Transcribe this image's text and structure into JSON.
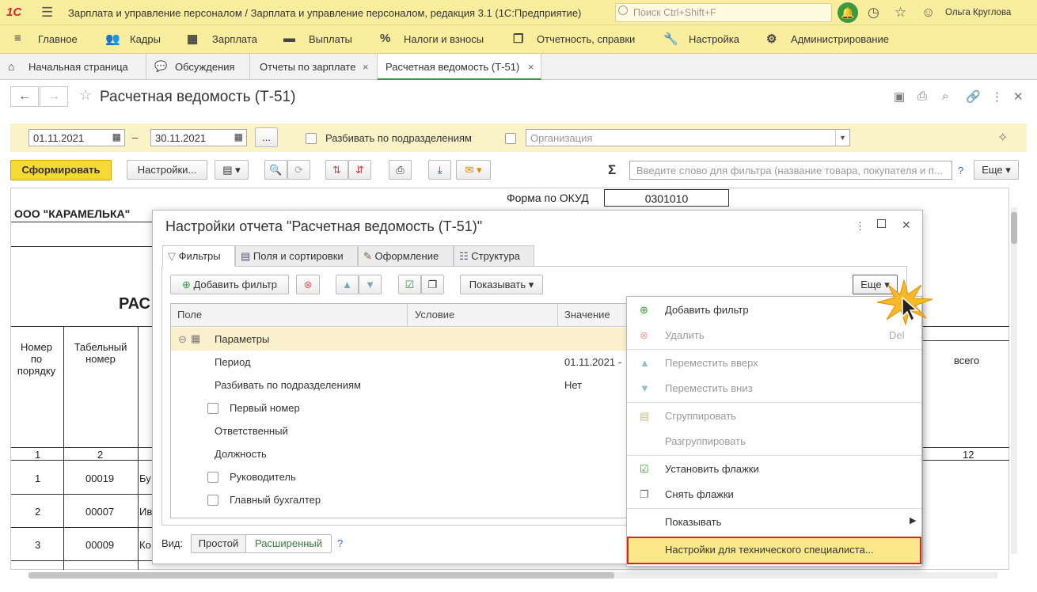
{
  "app": {
    "logo": "1С",
    "title": "Зарплата и управление персоналом / Зарплата и управление персоналом, редакция 3.1  (1С:Предприятие)",
    "search_placeholder": "Поиск Ctrl+Shift+F",
    "user": "Ольга Круглова"
  },
  "sections": [
    "Главное",
    "Кадры",
    "Зарплата",
    "Выплаты",
    "Налоги и взносы",
    "Отчетность, справки",
    "Настройка",
    "Администрирование"
  ],
  "tabs": [
    "Начальная страница",
    "Обсуждения",
    "Отчеты по зарплате",
    "Расчетная ведомость (Т-51)"
  ],
  "form": {
    "title": "Расчетная ведомость (Т-51)",
    "date_from": "01.11.2021",
    "dash": "–",
    "date_to": "30.11.2021",
    "dots": "...",
    "split_label": "Разбивать по подразделениям",
    "org_placeholder": "Организация",
    "generate": "Сформировать",
    "settings": "Настройки...",
    "filter_placeholder": "Введите слово для фильтра (название товара, покупателя и п...",
    "help": "?",
    "more": "Еще"
  },
  "report": {
    "okud_label": "Форма по ОКУД",
    "okud_code": "0301010",
    "org": "ООО \"КАРАМЕЛЬКА\"",
    "title_partial": "РАС",
    "col1": "Номер по порядку",
    "col2": "Табельный номер",
    "col_total": "всего",
    "num_row": [
      "1",
      "2",
      "12"
    ],
    "rows": [
      {
        "n": "1",
        "tab": "00019",
        "name": "Бу"
      },
      {
        "n": "2",
        "tab": "00007",
        "name": "Ив"
      },
      {
        "n": "3",
        "tab": "00009",
        "name": "Ко"
      }
    ]
  },
  "dialog": {
    "title": "Настройки отчета \"Расчетная ведомость (Т-51)\"",
    "tabs": [
      "Фильтры",
      "Поля и сортировки",
      "Оформление",
      "Структура"
    ],
    "add_filter": "Добавить фильтр",
    "show": "Показывать",
    "more": "Еще",
    "grid_headers": [
      "Поле",
      "Условие",
      "Значение"
    ],
    "rows": [
      {
        "label": "Параметры",
        "value": ""
      },
      {
        "label": "Период",
        "value": "01.11.2021 -"
      },
      {
        "label": "Разбивать по подразделениям",
        "value": "Нет"
      },
      {
        "label": "Первый номер",
        "value": ""
      },
      {
        "label": "Ответственный",
        "value": ""
      },
      {
        "label": "Должность",
        "value": ""
      },
      {
        "label": "Руководитель",
        "value": ""
      },
      {
        "label": "Главный бухгалтер",
        "value": ""
      }
    ],
    "view_label": "Вид:",
    "view_simple": "Простой",
    "view_extended": "Расширенный",
    "help": "?"
  },
  "menu": {
    "add_filter": "Добавить фильтр",
    "delete": "Удалить",
    "delete_key": "Del",
    "move_up": "Переместить вверх",
    "move_down": "Переместить вниз",
    "group": "Сгруппировать",
    "ungroup": "Разгруппировать",
    "check_all": "Установить флажки",
    "uncheck_all": "Снять флажки",
    "show": "Показывать",
    "tech": "Настройки для технического специалиста..."
  },
  "colors": {
    "accent_yellow": "#fbed9e",
    "button_yellow": "#f7d936",
    "green": "#3a9a3f",
    "highlight_red": "#dd2222"
  }
}
